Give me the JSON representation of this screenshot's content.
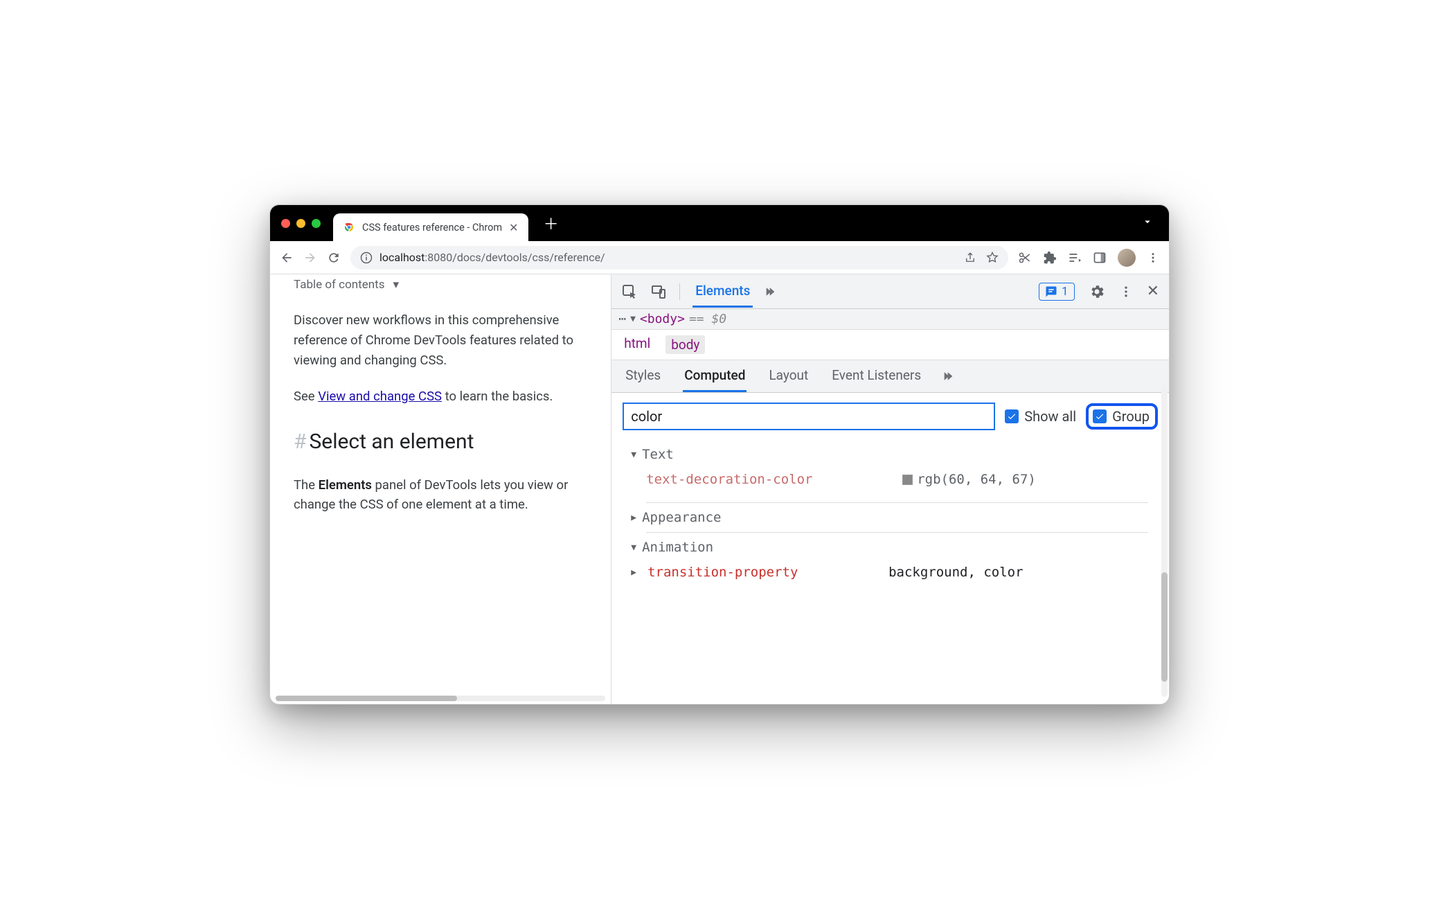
{
  "window": {
    "tab_title": "CSS features reference - Chrom",
    "url_host": "localhost",
    "url_port": ":8080",
    "url_path": "/docs/devtools/css/reference/"
  },
  "page": {
    "toc_label": "Table of contents",
    "para1_a": "Discover new workflows in this comprehensive reference of Chrome DevTools features related to viewing and changing CSS.",
    "para2_pre": "See ",
    "para2_link": "View and change CSS",
    "para2_post": " to learn the basics.",
    "heading": "Select an element",
    "para3_pre": "The ",
    "para3_bold": "Elements",
    "para3_post": " panel of DevTools lets you view or change the CSS of one element at a time."
  },
  "devtools": {
    "top_tab": "Elements",
    "msg_count": "1",
    "dom_tag": "<body>",
    "dom_eq": "== $0",
    "crumb1": "html",
    "crumb2": "body",
    "subtabs": {
      "styles": "Styles",
      "computed": "Computed",
      "layout": "Layout",
      "listeners": "Event Listeners"
    },
    "filter_value": "color",
    "show_all_label": "Show all",
    "group_label": "Group",
    "groups": {
      "text": {
        "label": "Text",
        "prop": "text-decoration-color",
        "val": "rgb(60, 64, 67)"
      },
      "appearance": {
        "label": "Appearance"
      },
      "animation": {
        "label": "Animation",
        "prop": "transition-property",
        "val": "background, color"
      }
    }
  }
}
